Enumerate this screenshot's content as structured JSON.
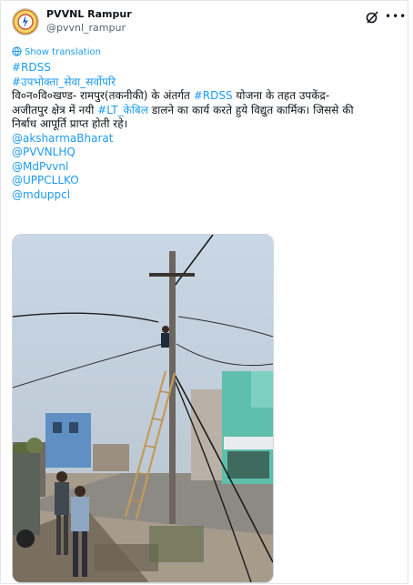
{
  "account": {
    "name": "PVVNL Rampur",
    "handle": "@pvvnl_rampur"
  },
  "translate": {
    "label": "Show translation"
  },
  "post": {
    "hashtag1": "#RDSS",
    "hashtag2": "#उपभोक्ता_सेवा_सर्वोपरि",
    "line1_a": "वि०न०वि०खण्ड- रामपुर(तकनीकी) के अंतर्गत ",
    "line1_tag": "#RDSS",
    "line1_b": " योजना के तहत उपकेंद्र-",
    "line2_a": "अजीतपुर क्षेत्र में नयी ",
    "line2_tag": "#LT_केबिल",
    "line2_b": " डालने का कार्य करते हुये विद्युत कार्मिक। जिससे की",
    "line3": "निर्बाध आपूर्ति प्राप्त होती रहे।",
    "mentions": [
      "@aksharmaBharat",
      "@PVVNLHQ",
      "@MdPvvnl",
      "@UPPCLLKO",
      "@mduppcl"
    ]
  },
  "colors": {
    "link": "#1d9bf0",
    "text": "#0f1419",
    "muted": "#536471"
  },
  "icons": [
    "avatar-logo",
    "grok-icon",
    "more-icon",
    "translate-icon"
  ]
}
